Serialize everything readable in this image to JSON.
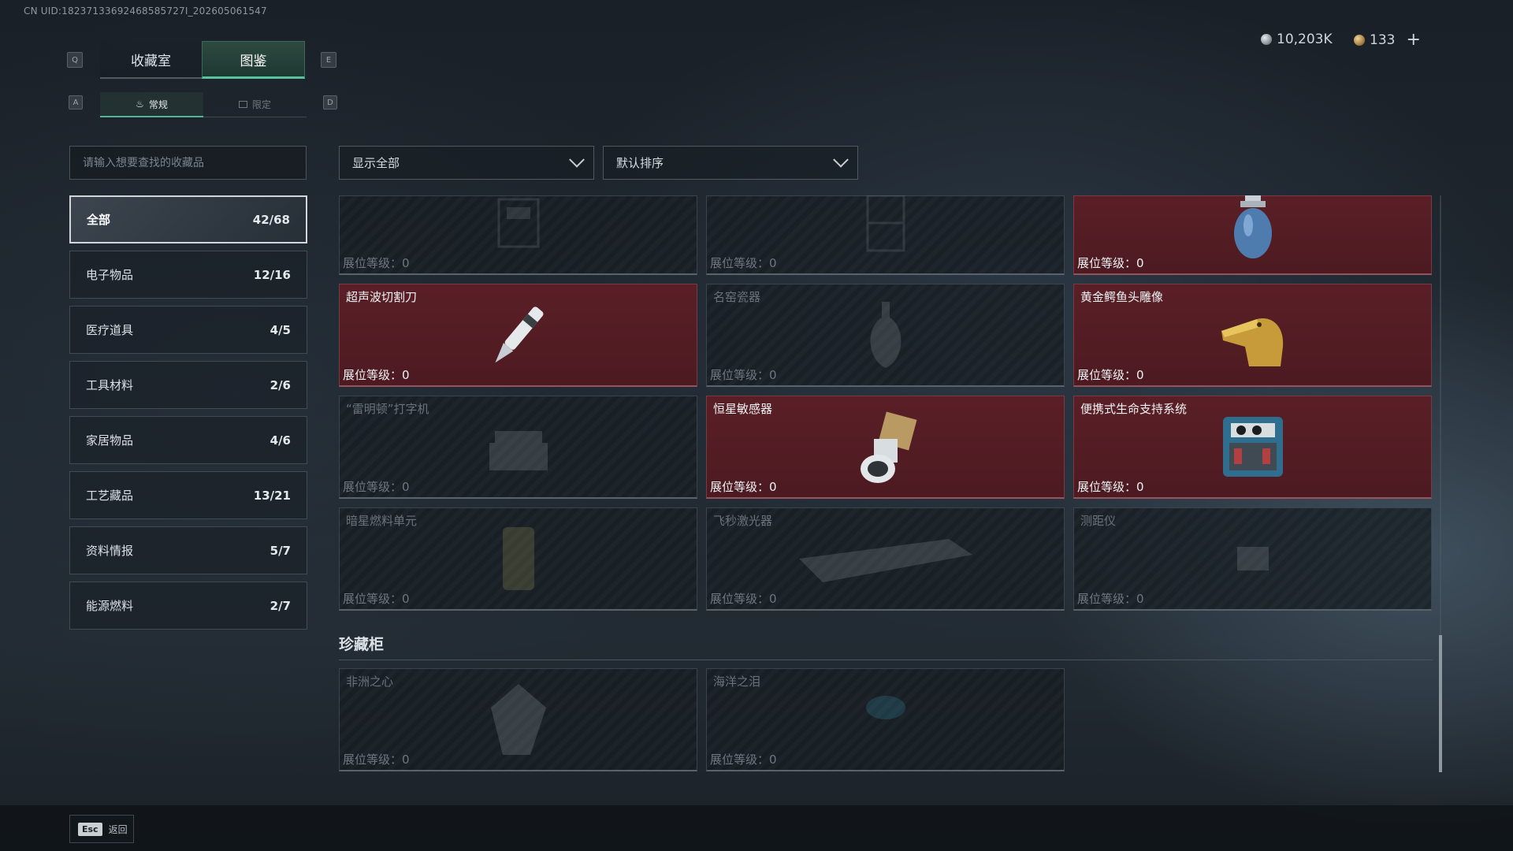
{
  "uid": "CN UID:18237133692468585727I_202605061547",
  "key_hints": {
    "q": "Q",
    "e": "E",
    "a": "A",
    "d": "D"
  },
  "main_tabs": [
    "收藏室",
    "图鉴"
  ],
  "sub_tabs": [
    "常规",
    "限定"
  ],
  "currency": {
    "silver": "10,203K",
    "gold": "133",
    "add": "+"
  },
  "search": {
    "placeholder": "请输入想要查找的收藏品"
  },
  "filters": {
    "show": "显示全部",
    "sort": "默认排序"
  },
  "categories": [
    {
      "label": "全部",
      "count": "42/68"
    },
    {
      "label": "电子物品",
      "count": "12/16"
    },
    {
      "label": "医疗道具",
      "count": "4/5"
    },
    {
      "label": "工具材料",
      "count": "2/6"
    },
    {
      "label": "家居物品",
      "count": "4/6"
    },
    {
      "label": "工艺藏品",
      "count": "13/21"
    },
    {
      "label": "资料情报",
      "count": "5/7"
    },
    {
      "label": "能源燃料",
      "count": "2/7"
    }
  ],
  "level_prefix": "展位等级：",
  "items": [
    {
      "name": "",
      "level": "0",
      "owned": false,
      "icon": "machine-icon"
    },
    {
      "name": "",
      "level": "0",
      "owned": false,
      "icon": "cabinet-icon"
    },
    {
      "name": "",
      "level": "0",
      "owned": true,
      "icon": "gas-canister-icon"
    },
    {
      "name": "超声波切割刀",
      "level": "0",
      "owned": true,
      "icon": "ultrasonic-knife-icon"
    },
    {
      "name": "名窑瓷器",
      "level": "0",
      "owned": false,
      "icon": "vase-icon"
    },
    {
      "name": "黄金鳄鱼头雕像",
      "level": "0",
      "owned": true,
      "icon": "golden-crocodile-icon"
    },
    {
      "name": "“雷明顿”打字机",
      "level": "0",
      "owned": false,
      "icon": "typewriter-icon"
    },
    {
      "name": "恒星敏感器",
      "level": "0",
      "owned": true,
      "icon": "star-sensor-icon"
    },
    {
      "name": "便携式生命支持系统",
      "level": "0",
      "owned": true,
      "icon": "life-support-icon"
    },
    {
      "name": "暗星燃料单元",
      "level": "0",
      "owned": false,
      "icon": "fuel-cell-icon"
    },
    {
      "name": "飞秒激光器",
      "level": "0",
      "owned": false,
      "icon": "laser-icon"
    },
    {
      "name": "测距仪",
      "level": "0",
      "owned": false,
      "icon": "rangefinder-icon"
    }
  ],
  "section_title": "珍藏柜",
  "treasure_items": [
    {
      "name": "非洲之心",
      "level": "0",
      "owned": false,
      "icon": "gem-icon"
    },
    {
      "name": "海洋之泪",
      "level": "0",
      "owned": false,
      "icon": "teardrop-gem-icon"
    }
  ],
  "bottom": {
    "esc_key": "Esc",
    "esc_label": "返回"
  }
}
